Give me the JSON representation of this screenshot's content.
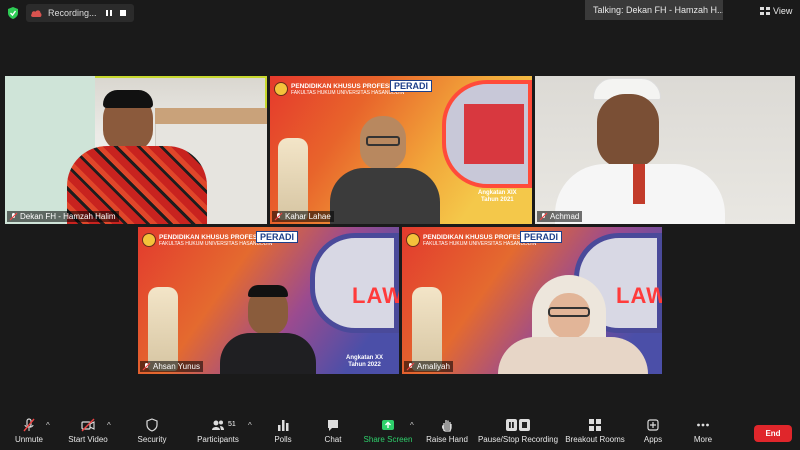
{
  "topbar": {
    "recording_label": "Recording...",
    "talking_label": "Talking: Dekan FH - Hamzah H...",
    "view_label": "View"
  },
  "banner": {
    "line1": "PENDIDIKAN KHUSUS PROFESI ADVOKAT",
    "line2": "FAKULTAS HUKUM UNIVERSITAS HASANUDDIN",
    "peradi": "PERADI"
  },
  "participants": [
    {
      "name": "Dekan FH - Hamzah Halim",
      "active": true
    },
    {
      "name": "Kahar Lahae",
      "angkatan": "Angkatan XIX",
      "tahun": "Tahun 2021"
    },
    {
      "name": "Achmad"
    },
    {
      "name": "Ahsan Yunus",
      "angkatan": "Angkatan XX",
      "tahun": "Tahun 2022",
      "law": "LAW"
    },
    {
      "name": "Amaliyah",
      "law": "LAW"
    }
  ],
  "toolbar": {
    "unmute": "Unmute",
    "start_video": "Start Video",
    "security": "Security",
    "participants": "Participants",
    "participants_count": "51",
    "polls": "Polls",
    "chat": "Chat",
    "share_screen": "Share Screen",
    "raise_hand": "Raise Hand",
    "pause_stop_recording": "Pause/Stop Recording",
    "breakout_rooms": "Breakout Rooms",
    "apps": "Apps",
    "more": "More",
    "end": "End"
  },
  "colors": {
    "active_outline": "#c8d82e",
    "share_green": "#2ecf6b",
    "end_red": "#e0262b",
    "shield_green": "#2ecc55"
  }
}
